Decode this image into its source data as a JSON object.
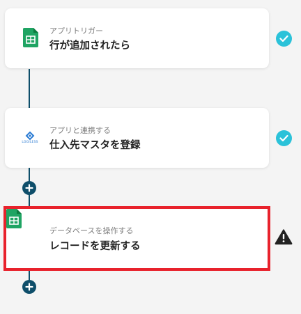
{
  "steps": [
    {
      "icon": "google-sheets-icon",
      "subtitle": "アプリトリガー",
      "title": "行が追加されたら",
      "status": "complete"
    },
    {
      "icon": "logiless-logo-icon",
      "icon_text": "LOGILESS",
      "subtitle": "アプリと連携する",
      "title": "仕入先マスタを登録",
      "status": "complete"
    },
    {
      "icon": "google-sheets-icon",
      "subtitle": "データベースを操作する",
      "title": "レコードを更新する",
      "status": "warning",
      "selected": true
    }
  ],
  "colors": {
    "background": "#f4f4f4",
    "connector": "#0e4e6a",
    "check": "#2bc2d9",
    "selected_border": "#e8222c",
    "sheets_green": "#1fa463"
  }
}
